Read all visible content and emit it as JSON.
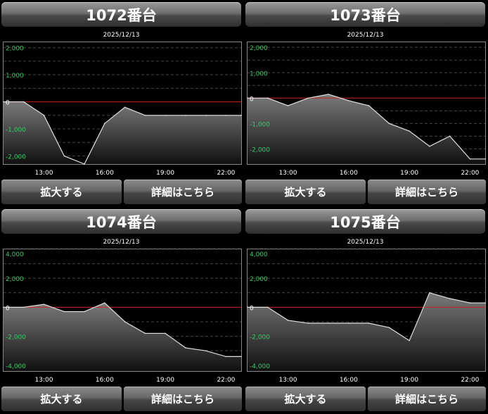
{
  "panels": [
    {
      "title": "1072番台",
      "date": "2025/12/13",
      "zoom_label": "拡大する",
      "detail_label": "詳細はこちら",
      "chart_data": {
        "type": "area",
        "x": [
          "11:00",
          "12:00",
          "13:00",
          "14:00",
          "15:00",
          "16:00",
          "17:00",
          "18:00",
          "19:00",
          "20:00",
          "21:00",
          "22:00",
          "22:45"
        ],
        "y": [
          0,
          0,
          -500,
          -2000,
          -2300,
          -800,
          -200,
          -500,
          -500,
          -500,
          -500,
          -500,
          -500
        ],
        "ylim": [
          -2300,
          2200
        ],
        "y_ticks": [
          2000,
          1000,
          0,
          -1000,
          -2000
        ],
        "y_tick_labels": [
          "2,000",
          "1,000",
          "0",
          "-1,000",
          "-2,000"
        ],
        "x_ticks": [
          "13:00",
          "16:00",
          "19:00",
          "22:00"
        ],
        "zero_line_color": "#cc2222",
        "tick_color": "#33cc66"
      }
    },
    {
      "title": "1073番台",
      "date": "2025/12/13",
      "zoom_label": "拡大する",
      "detail_label": "詳細はこちら",
      "chart_data": {
        "type": "area",
        "x": [
          "11:00",
          "12:00",
          "13:00",
          "14:00",
          "15:00",
          "16:00",
          "17:00",
          "18:00",
          "19:00",
          "20:00",
          "21:00",
          "22:00",
          "22:45"
        ],
        "y": [
          0,
          0,
          -300,
          0,
          150,
          -100,
          -300,
          -1000,
          -1300,
          -1900,
          -1500,
          -2400,
          -2400
        ],
        "ylim": [
          -2600,
          2200
        ],
        "y_ticks": [
          2000,
          1000,
          0,
          -1000,
          -2000
        ],
        "y_tick_labels": [
          "2,000",
          "1,000",
          "0",
          "-1,000",
          "-2,000"
        ],
        "x_ticks": [
          "13:00",
          "16:00",
          "19:00",
          "22:00"
        ],
        "zero_line_color": "#cc2222",
        "tick_color": "#33cc66"
      }
    },
    {
      "title": "1074番台",
      "date": "2025/12/13",
      "zoom_label": "拡大する",
      "detail_label": "詳細はこちら",
      "chart_data": {
        "type": "area",
        "x": [
          "11:00",
          "12:00",
          "13:00",
          "14:00",
          "15:00",
          "16:00",
          "17:00",
          "18:00",
          "19:00",
          "20:00",
          "21:00",
          "22:00",
          "22:45"
        ],
        "y": [
          0,
          0,
          200,
          -300,
          -300,
          300,
          -1000,
          -1800,
          -1800,
          -2800,
          -3000,
          -3400,
          -3400
        ],
        "ylim": [
          -4400,
          4000
        ],
        "y_ticks": [
          4000,
          2000,
          0,
          -2000,
          -4000
        ],
        "y_tick_labels": [
          "4,000",
          "2,000",
          "0",
          "-2,000",
          "-4,000"
        ],
        "x_ticks": [
          "13:00",
          "16:00",
          "19:00",
          "22:00"
        ],
        "zero_line_color": "#cc2222",
        "tick_color": "#33cc66"
      }
    },
    {
      "title": "1075番台",
      "date": "2025/12/13",
      "zoom_label": "拡大する",
      "detail_label": "詳細はこちら",
      "chart_data": {
        "type": "area",
        "x": [
          "11:00",
          "12:00",
          "13:00",
          "14:00",
          "15:00",
          "16:00",
          "17:00",
          "18:00",
          "19:00",
          "20:00",
          "21:00",
          "22:00",
          "22:45"
        ],
        "y": [
          0,
          0,
          -900,
          -1100,
          -1100,
          -1100,
          -1100,
          -1400,
          -2300,
          1000,
          600,
          300,
          300
        ],
        "ylim": [
          -4400,
          4000
        ],
        "y_ticks": [
          4000,
          2000,
          0,
          -2000,
          -4000
        ],
        "y_tick_labels": [
          "4,000",
          "2,000",
          "0",
          "-2,000",
          "-4,000"
        ],
        "x_ticks": [
          "13:00",
          "16:00",
          "19:00",
          "22:00"
        ],
        "zero_line_color": "#cc2222",
        "tick_color": "#33cc66"
      }
    }
  ]
}
